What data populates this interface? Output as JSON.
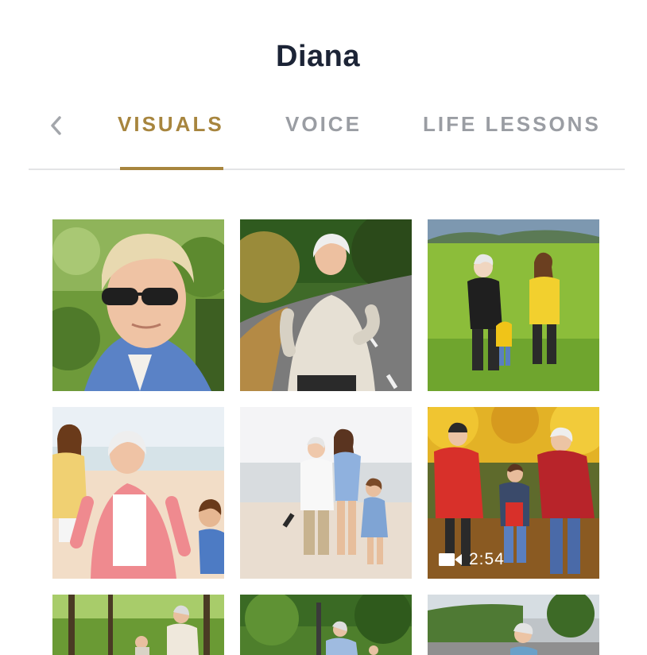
{
  "header": {
    "title": "Diana"
  },
  "tabs": [
    {
      "label": "VISUALS",
      "active": true
    },
    {
      "label": "VOICE",
      "active": false
    },
    {
      "label": "LIFE LESSONS",
      "active": false
    }
  ],
  "colors": {
    "accent": "#a7853e",
    "title": "#1c2436",
    "tab_inactive": "#9a9da3"
  },
  "icons": {
    "back": "chevron-left-icon",
    "video": "video-camera-icon"
  },
  "gallery": {
    "items": [
      {
        "kind": "photo"
      },
      {
        "kind": "photo"
      },
      {
        "kind": "photo"
      },
      {
        "kind": "photo"
      },
      {
        "kind": "photo"
      },
      {
        "kind": "video",
        "duration": "2:54"
      },
      {
        "kind": "photo"
      },
      {
        "kind": "photo"
      },
      {
        "kind": "photo"
      }
    ]
  }
}
